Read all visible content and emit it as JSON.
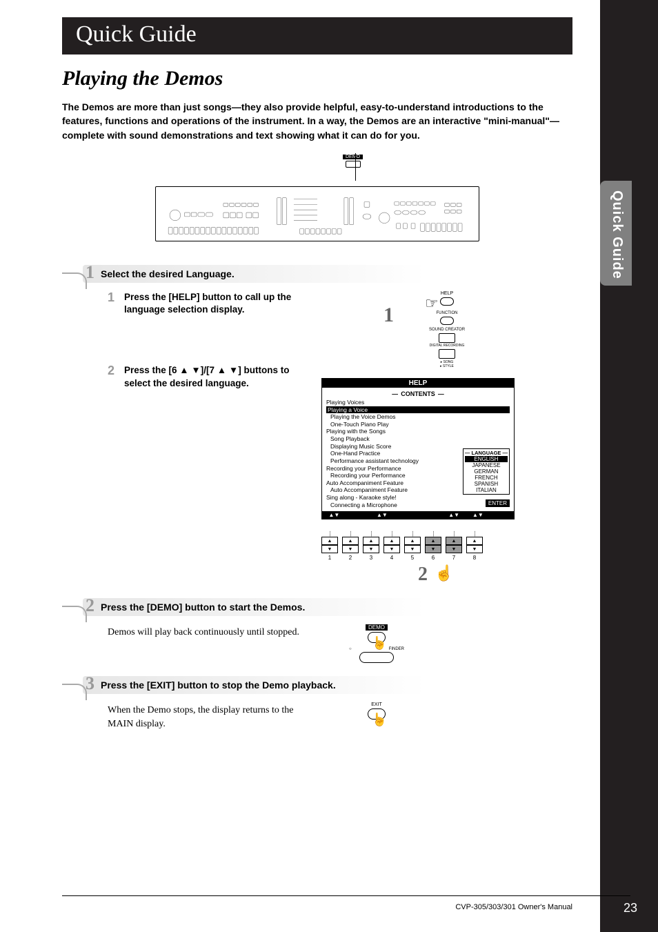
{
  "header": "Quick Guide",
  "side_tab": "Quick Guide",
  "section_title": "Playing the Demos",
  "intro": "The Demos are more than just songs—they also provide helpful, easy-to-understand introductions to the features, functions and operations of the instrument. In a way, the Demos are an interactive \"mini-manual\"—complete with sound demonstrations and text showing what it can do for you.",
  "demo_callout": "DEMO",
  "steps": {
    "s1": {
      "num": "1",
      "title": "Select the desired Language.",
      "sub1": {
        "num": "1",
        "text": "Press the [HELP] button to call up the language selection display."
      },
      "sub2": {
        "num": "2",
        "text": "Press the [6 ▲ ▼]/[7 ▲ ▼] buttons to select the desired language."
      },
      "help_labels": {
        "help": "HELP",
        "function": "FUNCTION",
        "sound_creator": "SOUND CREATOR",
        "digital": "DIGITAL RECORDING",
        "song_style": "SONG STYLE"
      },
      "callout1": "1",
      "callout2": "2"
    },
    "s2": {
      "num": "2",
      "title": "Press the [DEMO] button to start the Demos.",
      "body": "Demos will play back continuously until stopped.",
      "labels": {
        "demo": "DEMO",
        "finder": "FINDER"
      }
    },
    "s3": {
      "num": "3",
      "title": "Press the [EXIT] button to stop the Demo playback.",
      "body": "When the Demo stops, the display returns to the MAIN display.",
      "labels": {
        "exit": "EXIT"
      }
    }
  },
  "help_screen": {
    "title": "HELP",
    "contents_label": "CONTENTS",
    "items": [
      "Playing Voices",
      "Playing a Voice",
      "Playing the Voice Demos",
      "One-Touch Piano Play",
      "Playing with the Songs",
      "Song Playback",
      "Displaying Music Score",
      "One-Hand Practice",
      "Performance assistant technology",
      "Recording your Performance",
      "Recording your Performance",
      "Auto Accompaniment Feature",
      "Auto Accompaniment Feature",
      "Sing along - Karaoke style!",
      "Connecting a Microphone"
    ],
    "selected_index": 1,
    "language_label": "LANGUAGE",
    "languages": [
      "ENGLISH",
      "JAPANESE",
      "GERMAN",
      "FRENCH",
      "SPANISH",
      "ITALIAN"
    ],
    "language_selected": 0,
    "enter": "ENTER",
    "footer_marks": [
      "▲▼",
      "",
      "▲▼",
      "",
      "",
      "▲▼",
      "▲▼",
      ""
    ]
  },
  "button_row": [
    "1",
    "2",
    "3",
    "4",
    "5",
    "6",
    "7",
    "8"
  ],
  "footer": "CVP-305/303/301 Owner's Manual",
  "page_num": "23"
}
